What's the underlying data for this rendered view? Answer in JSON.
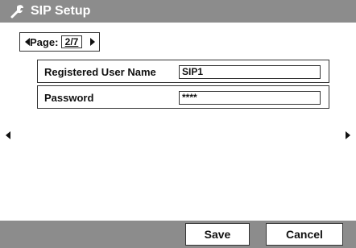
{
  "window": {
    "title": "SIP Setup",
    "title_icon": "settings-wrench-icon"
  },
  "pager": {
    "label": "Page:",
    "value": "2/7",
    "prev_icon": "triangle-left-icon",
    "next_icon": "triangle-right-icon"
  },
  "fields": [
    {
      "label": "Registered User Name",
      "value": "SIP1"
    },
    {
      "label": "Password",
      "value": "****"
    }
  ],
  "side_nav": {
    "left_icon": "triangle-left-icon",
    "right_icon": "triangle-right-icon"
  },
  "footer": {
    "save_label": "Save",
    "cancel_label": "Cancel"
  },
  "colors": {
    "titlebar": "#8c8c8c",
    "footer": "#8c8c8c",
    "title_text": "#ffffff",
    "border": "#333333"
  }
}
